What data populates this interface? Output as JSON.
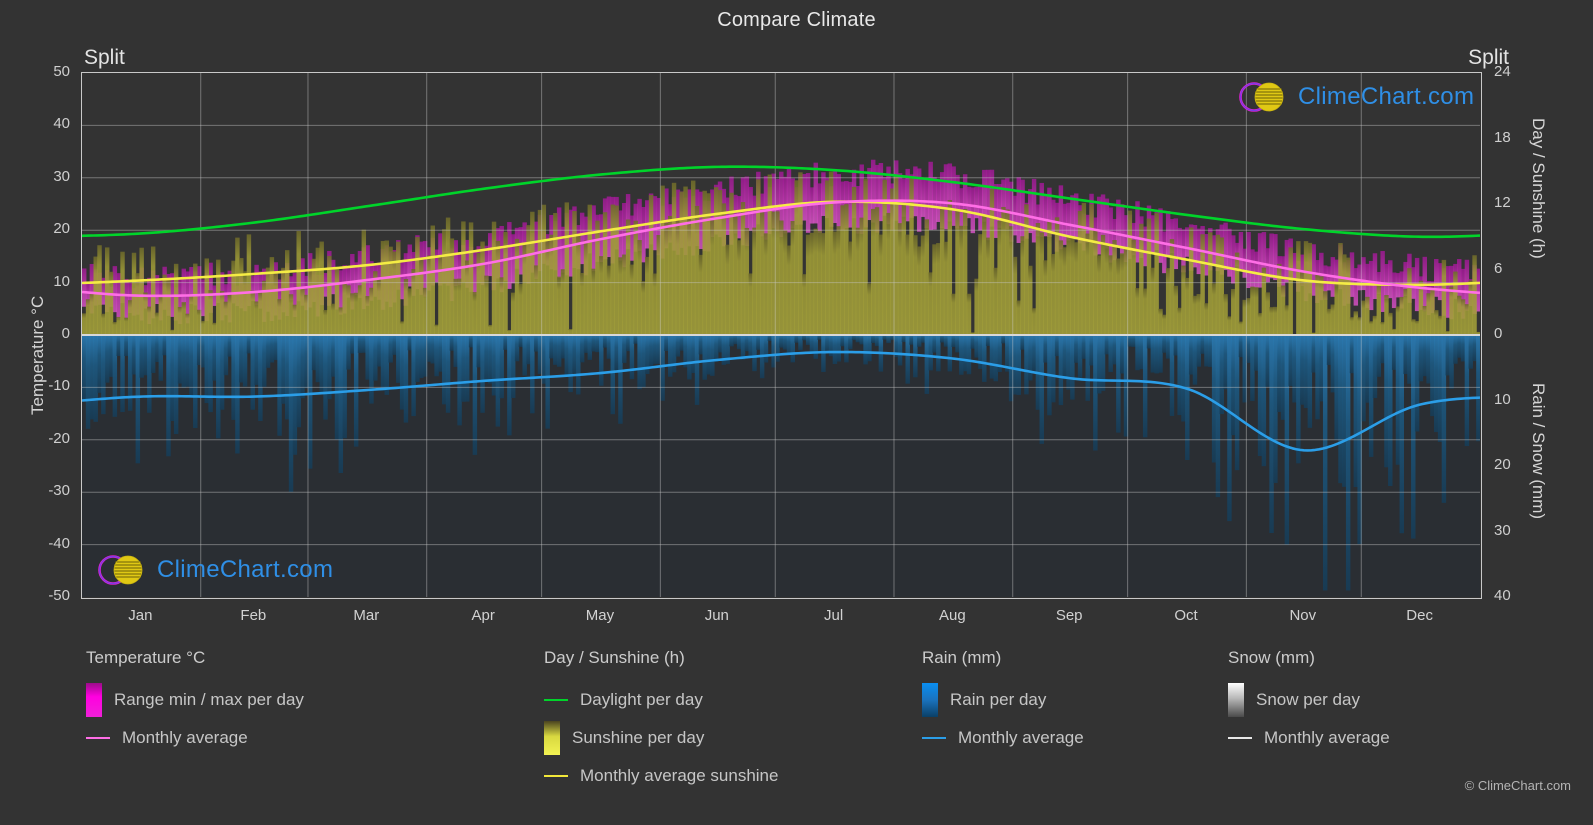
{
  "header": {
    "title": "Compare Climate",
    "location_left": "Split",
    "location_right": "Split"
  },
  "branding": {
    "logo_text": "ClimeChart.com",
    "copyright": "© ClimeChart.com"
  },
  "axes": {
    "y_left_title": "Temperature °C",
    "y_left_ticks": [
      "50",
      "40",
      "30",
      "20",
      "10",
      "0",
      "-10",
      "-20",
      "-30",
      "-40",
      "-50"
    ],
    "y_right_top_title": "Day / Sunshine (h)",
    "y_right_top_ticks": [
      "24",
      "18",
      "12",
      "6",
      "0"
    ],
    "y_right_bottom_title": "Rain / Snow (mm)",
    "y_right_bottom_ticks": [
      "0",
      "10",
      "20",
      "30",
      "40"
    ],
    "x_ticks": [
      "Jan",
      "Feb",
      "Mar",
      "Apr",
      "May",
      "Jun",
      "Jul",
      "Aug",
      "Sep",
      "Oct",
      "Nov",
      "Dec"
    ]
  },
  "legend": {
    "groups": [
      {
        "title": "Temperature °C",
        "items": [
          {
            "label": "Range min / max per day",
            "swatch": "gradient",
            "color": "#ff00e0",
            "color2": "#8a0077"
          },
          {
            "label": "Monthly average",
            "swatch": "line",
            "color": "#ff6ee6"
          }
        ]
      },
      {
        "title": "Day / Sunshine (h)",
        "items": [
          {
            "label": "Daylight per day",
            "swatch": "line",
            "color": "#00d42a"
          },
          {
            "label": "Sunshine per day",
            "swatch": "gradient",
            "color": "#f2f252",
            "color2": "#4a4420"
          },
          {
            "label": "Monthly average sunshine",
            "swatch": "line",
            "color": "#f2e83a"
          }
        ]
      },
      {
        "title": "Rain (mm)",
        "items": [
          {
            "label": "Rain per day",
            "swatch": "gradient",
            "color": "#0a8ef0",
            "color2": "#0b3f66"
          },
          {
            "label": "Monthly average",
            "swatch": "line",
            "color": "#2b9ee8"
          }
        ]
      },
      {
        "title": "Snow (mm)",
        "items": [
          {
            "label": "Snow per day",
            "swatch": "gradient",
            "color": "#ffffff",
            "color2": "#4a4a4a"
          },
          {
            "label": "Monthly average",
            "swatch": "line",
            "color": "#e8e8e8"
          }
        ]
      }
    ]
  },
  "colors": {
    "background": "#333333",
    "grid": "#8f8f8f",
    "frame": "#c9c9c9",
    "daylight": "#00d42a",
    "sunshine_fill": "#9a9a33",
    "sunshine_avg": "#f2e83a",
    "temp_range": "#c41fb4",
    "temp_avg": "#ff6ee6",
    "rain_fill": "#17496e",
    "rain_avg": "#2b9ee8",
    "logo_blue": "#2f8fe6",
    "logo_magenta": "#e020d0",
    "logo_yellow": "#e8d018"
  },
  "chart_data": {
    "type": "area",
    "title": "Compare Climate",
    "subtitle": "Split",
    "xlabel": "",
    "ylabel": "Temperature °C",
    "grid": true,
    "legend_position": "below",
    "x": [
      "Jan",
      "Feb",
      "Mar",
      "Apr",
      "May",
      "Jun",
      "Jul",
      "Aug",
      "Sep",
      "Oct",
      "Nov",
      "Dec"
    ],
    "axis_left": {
      "label": "Temperature °C",
      "min": -50,
      "max": 50,
      "step": 10
    },
    "axis_right_top": {
      "label": "Day / Sunshine (h)",
      "min": 0,
      "max": 24,
      "step": 6,
      "maps_to_temperature": [
        0,
        50
      ]
    },
    "axis_right_bottom": {
      "label": "Rain / Snow (mm)",
      "min": 0,
      "max": 40,
      "step": 10,
      "maps_to_temperature": [
        0,
        -50
      ]
    },
    "series": [
      {
        "name": "Monthly average",
        "unit": "°C",
        "axis": "left",
        "color": "#ff6ee6",
        "type": "line",
        "values": [
          7.5,
          8.2,
          10.5,
          13.6,
          18.3,
          22.3,
          25.3,
          25.1,
          21.0,
          16.6,
          12.1,
          9.0
        ]
      },
      {
        "name": "Range min per day",
        "unit": "°C",
        "axis": "left",
        "color": "#c41fb4",
        "type": "band-low",
        "values": [
          4.0,
          4.5,
          6.5,
          9.5,
          14.0,
          18.0,
          21.0,
          21.0,
          17.0,
          13.0,
          8.5,
          5.5
        ]
      },
      {
        "name": "Range max per day",
        "unit": "°C",
        "axis": "left",
        "color": "#c41fb4",
        "type": "band-high",
        "values": [
          11.0,
          12.0,
          15.0,
          18.5,
          23.5,
          27.5,
          30.5,
          30.0,
          25.5,
          21.0,
          16.0,
          12.5
        ]
      },
      {
        "name": "Daylight per day",
        "unit": "h",
        "axis": "right-top",
        "color": "#00d42a",
        "type": "line",
        "values": [
          9.3,
          10.3,
          11.8,
          13.4,
          14.7,
          15.4,
          15.1,
          14.0,
          12.5,
          11.0,
          9.7,
          9.0
        ]
      },
      {
        "name": "Monthly average sunshine",
        "unit": "h",
        "axis": "right-top",
        "color": "#f2e83a",
        "type": "line",
        "values": [
          5.0,
          5.6,
          6.4,
          7.8,
          9.5,
          11.1,
          12.2,
          11.5,
          9.0,
          6.9,
          5.0,
          4.6
        ]
      },
      {
        "name": "Monthly average rain",
        "unit": "mm",
        "axis": "right-bottom",
        "color": "#2b9ee8",
        "type": "line",
        "values": [
          9.4,
          9.4,
          8.4,
          7.0,
          5.8,
          3.8,
          2.6,
          3.6,
          6.6,
          8.2,
          17.6,
          10.6
        ]
      }
    ]
  }
}
